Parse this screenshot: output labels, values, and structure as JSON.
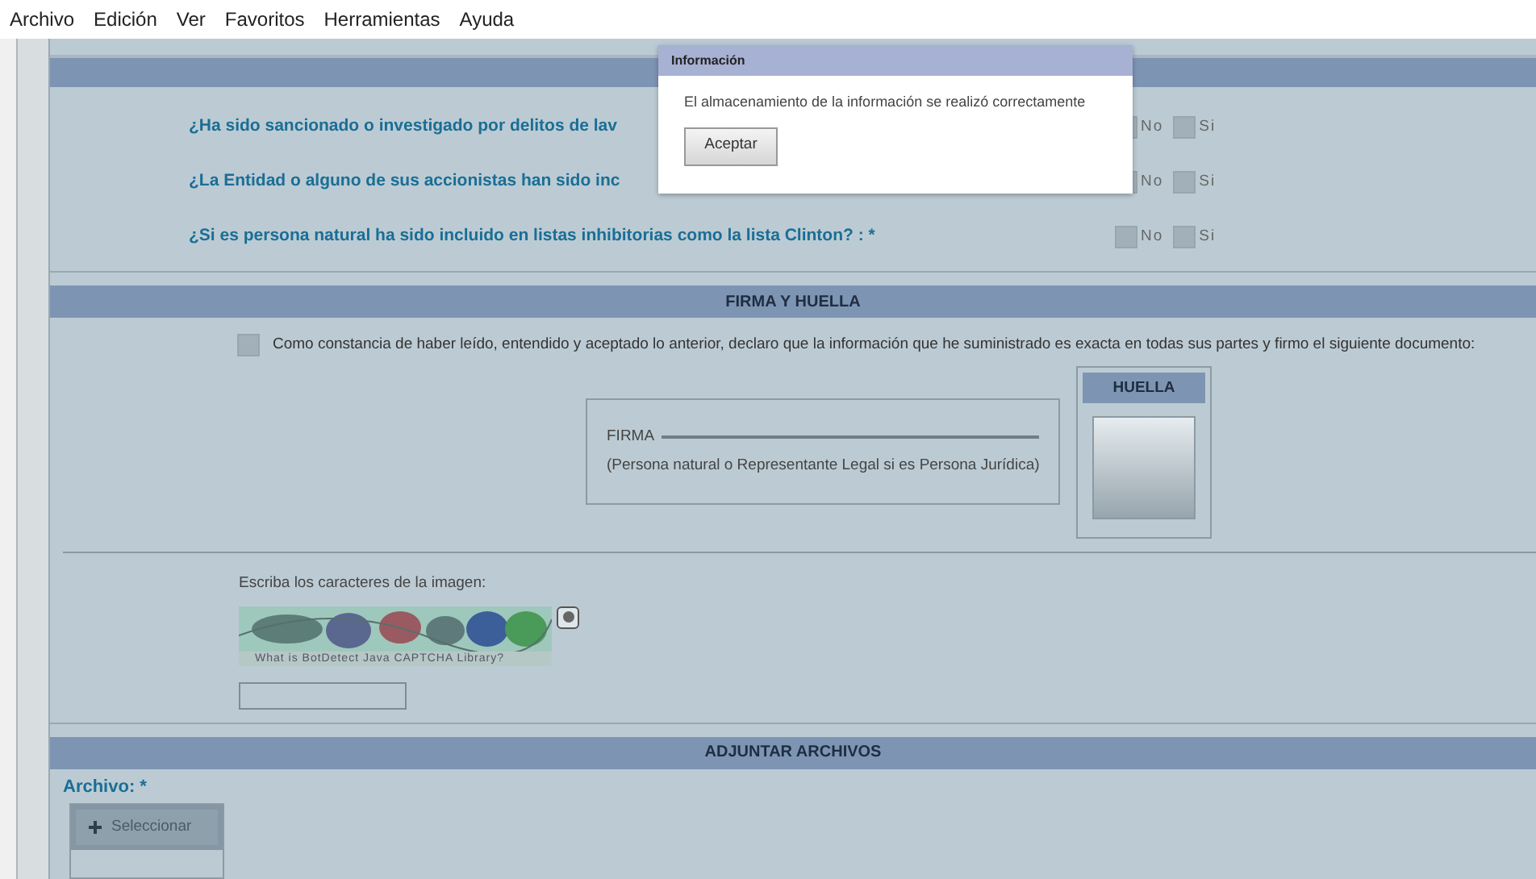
{
  "menu": [
    "Archivo",
    "Edición",
    "Ver",
    "Favoritos",
    "Herramientas",
    "Ayuda"
  ],
  "questions": [
    {
      "text": "¿Ha sido sancionado o investigado por delitos de lav",
      "options": [
        {
          "label": "No",
          "checked": false
        },
        {
          "label": "Si",
          "checked": false
        }
      ]
    },
    {
      "text": "¿La Entidad o alguno de sus accionistas han sido inc",
      "options": [
        {
          "label": "No",
          "checked": false
        },
        {
          "label": "Si",
          "checked": false
        }
      ]
    },
    {
      "text": "¿Si es persona natural ha sido incluido en listas inhibitorias como la lista Clinton? : *",
      "options": [
        {
          "label": "No",
          "checked": false
        },
        {
          "label": "Si",
          "checked": false
        }
      ]
    }
  ],
  "firma_section": {
    "title": "FIRMA Y HUELLA",
    "declaration": {
      "text": "Como constancia de haber leído, entendido y aceptado lo anterior, declaro que la información que he suministrado es exacta en todas sus partes y firmo el siguiente documento:",
      "checked": false
    },
    "signature_label": "FIRMA",
    "signature_note": "(Persona natural o Representante Legal si es Persona Jurídica)",
    "fingerprint_title": "HUELLA"
  },
  "captcha": {
    "label": "Escriba los caracteres de la imagen:",
    "link": "What is BotDetect Java CAPTCHA Library?"
  },
  "attachments": {
    "title": "ADJUNTAR ARCHIVOS",
    "field_label": "Archivo: *",
    "button": "Seleccionar"
  },
  "dialog": {
    "title": "Información",
    "message": "El almacenamiento de la información se realizó correctamente",
    "button": "Aceptar"
  }
}
